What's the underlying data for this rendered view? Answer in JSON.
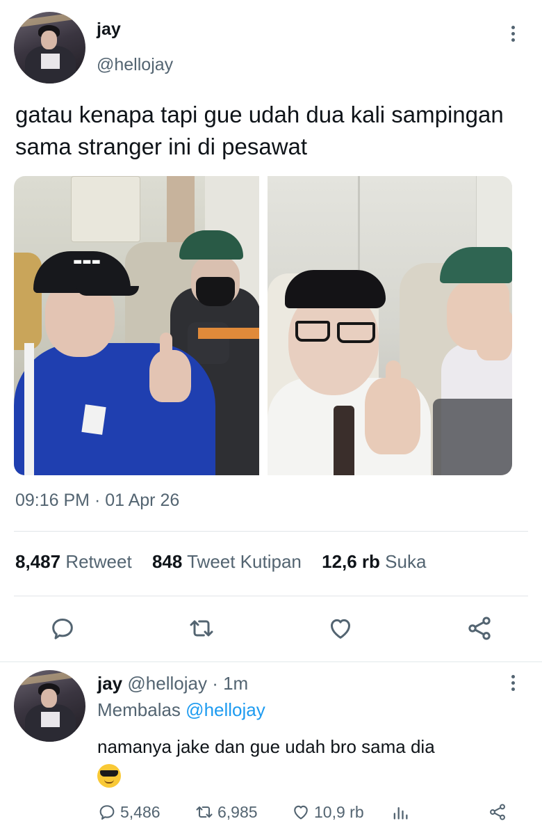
{
  "tweet": {
    "name": "jay",
    "handle": "@hellojay",
    "text": "gatau kenapa tapi gue udah dua kali sampingan sama stranger ini di pesawat",
    "timestamp": "09:16 PM · 01 Apr 26",
    "stats": [
      {
        "value": "8,487",
        "label": "Retweet"
      },
      {
        "value": "848",
        "label": "Tweet Kutipan"
      },
      {
        "value": "12,6 rb",
        "label": "Suka"
      }
    ],
    "actions": [
      "reply-icon",
      "retweet-icon",
      "like-icon",
      "share-icon"
    ]
  },
  "reply": {
    "name": "jay",
    "handle": "@hellojay",
    "time": "· 1m",
    "replying_prefix": "Membalas",
    "replying_to": "@hellojay",
    "text": "namanya jake dan gue udah bro sama dia",
    "emoji": "smiling-face-with-sunglasses",
    "counts": {
      "replies": "5,486",
      "retweets": "6,985",
      "likes": "10,9 rb"
    }
  },
  "colors": {
    "text_primary": "#0f1419",
    "text_secondary": "#536471",
    "link": "#1d9bf0",
    "divider": "#e1e5e8",
    "jacket_blue": "#1f3fb0"
  }
}
